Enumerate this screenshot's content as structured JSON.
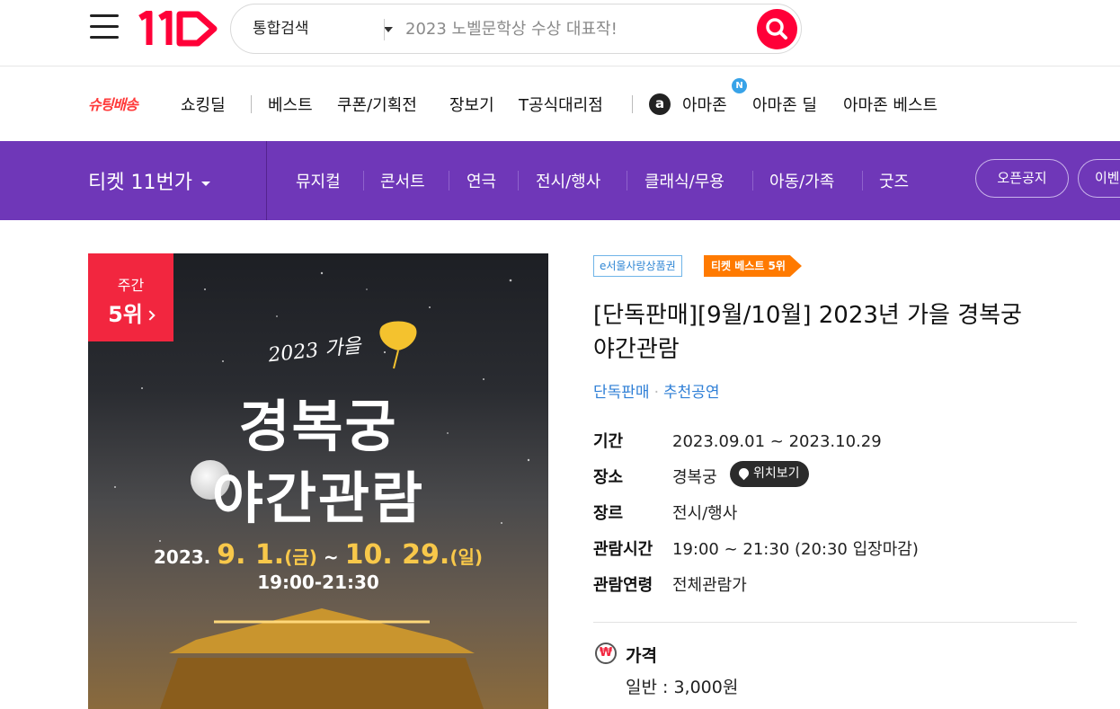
{
  "header": {
    "logo_text": "11",
    "search": {
      "category": "통합검색",
      "placeholder": "2023 노벨문학상 수상 대표작!"
    }
  },
  "subnav": {
    "brand": "슈팅배송",
    "items": [
      "쇼킹딜",
      "베스트",
      "쿠폰/기획전",
      "장보기",
      "T공식대리점"
    ],
    "amazon_icon": "a",
    "new_badge": "N",
    "amazon_items": [
      "아마존",
      "아마존 딜",
      "아마존 베스트"
    ]
  },
  "category_bar": {
    "title": "티켓 11번가",
    "categories": [
      "뮤지컬",
      "콘서트",
      "연극",
      "전시/행사",
      "클래식/무용",
      "아동/가족",
      "굿즈"
    ],
    "pills": [
      "오픈공지",
      "이벤"
    ]
  },
  "poster": {
    "rank_period": "주간",
    "rank": "5위",
    "year_text": "2023 가을",
    "title_line1": "경복궁",
    "title_line2": "야간관람",
    "date_prefix": "2023.",
    "date_start": "9. 1.",
    "date_start_day": "(금)",
    "date_sep": " ~ ",
    "date_end": "10. 29.",
    "date_end_day": "(일)",
    "hours": "19:00-21:30"
  },
  "product": {
    "tag_seoul": "e서울사랑상품권",
    "tag_best": "티켓 베스트 5위",
    "title": "[단독판매][9월/10월] 2023년 가을 경복궁 야간관람",
    "link1": "단독판매",
    "link2": "추천공연",
    "info": {
      "period_label": "기간",
      "period_value": "2023.09.01 ~ 2023.10.29",
      "place_label": "장소",
      "place_value": "경복궁",
      "location_button": "위치보기",
      "genre_label": "장르",
      "genre_value": "전시/행사",
      "time_label": "관람시간",
      "time_value": "19:00 ~ 21:30 (20:30 입장마감)",
      "age_label": "관람연령",
      "age_value": "전체관람가"
    },
    "price": {
      "icon": "₩",
      "label": "가격",
      "general_label": "일반",
      "general_value": "3,000원"
    }
  },
  "colors": {
    "brand_red": "#ff0038",
    "purple": "#6f37b8",
    "rank_red": "#f2263f",
    "best_orange": "#ff7a00",
    "link_blue": "#2f7fd6"
  }
}
